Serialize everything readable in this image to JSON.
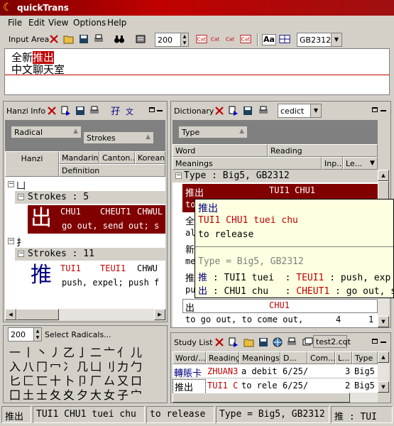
{
  "title": "quickTrans",
  "menu": [
    "File",
    "Edit",
    "View",
    "Options",
    "Help"
  ],
  "toolbar": {
    "input_area": "Input Area",
    "size": "200",
    "encoding": "GB2312",
    "aa": "Aa"
  },
  "input": {
    "line1_pre": "全新",
    "line1_hl": "推出",
    "line2": "中文聊天室"
  },
  "hanzi_info": {
    "title": "Hanzi Info",
    "radical": "Radical",
    "strokes": "Strokes",
    "columns": [
      "Hanzi",
      "Mandarin",
      "Canton...",
      "Korean",
      "Definition"
    ],
    "root": "凵",
    "group1": "Strokes : 5",
    "char1": "出",
    "char1_m": "CHU1",
    "char1_c": "CHEUT1",
    "char1_k": "CHWUL",
    "char1_def": "go out, send out; s",
    "root2": "扌",
    "group2": "Strokes : 11",
    "char2": "推",
    "char2_m": "TUI1",
    "char2_c": "TEUI1",
    "char2_k": "CHWU",
    "char2_def": "push, expel; push f"
  },
  "radicals": {
    "size": "200",
    "select": "Select Radicals...",
    "rows": [
      "一丨丶丿乙亅二亠亻儿",
      "入八冂冖冫几凵刂力勹",
      "匕匚匸十卜卩厂厶又口",
      "囗土士夂夊夕大女子宀"
    ]
  },
  "dictionary": {
    "title": "Dictionary",
    "source": "cedict",
    "type": "Type",
    "columns": [
      "Word",
      "Reading",
      "Meanings",
      "Inp...",
      "Le..."
    ],
    "group": "Type : Big5, GB2312",
    "row1_word": "推出",
    "row1_reading": "TUI1 CHU1",
    "row2_word": "to",
    "row3_word": "全",
    "row4_word": "al",
    "row5_word": "新",
    "row6_word": "me",
    "row7_word": "推",
    "row8_word": "pu",
    "row9_word": "出",
    "row9_reading": "CHU1",
    "row10_meaning": "to go out, to come out,",
    "row10_inp": "4",
    "row10_le": "1"
  },
  "tooltip": {
    "word": "推出",
    "reading": "TUI1 CHU1 tuei chu",
    "meaning": "to release",
    "type": "Type = Big5, GB2312",
    "line1_char": "推",
    "line1_rest": " : TUI1 tuei  : ",
    "line1_red": "TEUI1",
    "line1_tail": " : push, exp",
    "line2_char": "出",
    "line2_rest": " : CHU1 chu   : ",
    "line2_red": "CHEUT1",
    "line2_tail": " : go out, s"
  },
  "study": {
    "title": "Study List",
    "file": "test2.cqt",
    "columns": [
      "Word/...",
      "Reading",
      "Meanings",
      "D...",
      "Com...",
      "L...",
      "Type"
    ],
    "rows": [
      {
        "word": "轉賬卡",
        "reading": "ZHUAN3",
        "meaning": "a debit",
        "date": "6/25/",
        "com": "",
        "l": "3",
        "type": "Big5"
      },
      {
        "word": "推出",
        "reading": "TUI1 C",
        "meaning": "to rele",
        "date": "6/25/",
        "com": "",
        "l": "2",
        "type": "Big5"
      }
    ]
  },
  "status": [
    "推出",
    "TUI1 CHU1 tuei chu",
    "to release",
    "Type = Big5, GB2312",
    "推 : TUI"
  ]
}
